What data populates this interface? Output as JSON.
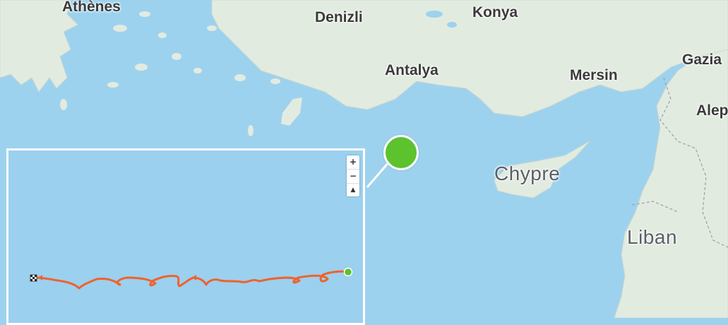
{
  "map": {
    "cities": {
      "athenes": "Athènes",
      "denizli": "Denizli",
      "konya": "Konya",
      "antalya": "Antalya",
      "mersin": "Mersin",
      "gaziantep": "Gazia",
      "alep": "Alep"
    },
    "countries": {
      "chypre": "Chypre",
      "liban": "Liban"
    }
  },
  "inset": {
    "zoom_in": "+",
    "zoom_out": "−",
    "reset_north": "▲"
  },
  "colors": {
    "sea": "#9dd2ee",
    "land": "#e2ebe0",
    "track": "#f0622c",
    "start_marker": "#5cc22e",
    "border": "#ffffff"
  },
  "icons": {
    "finish": "checkered-flag-icon",
    "start": "start-marker-icon",
    "location": "location-marker-icon"
  }
}
